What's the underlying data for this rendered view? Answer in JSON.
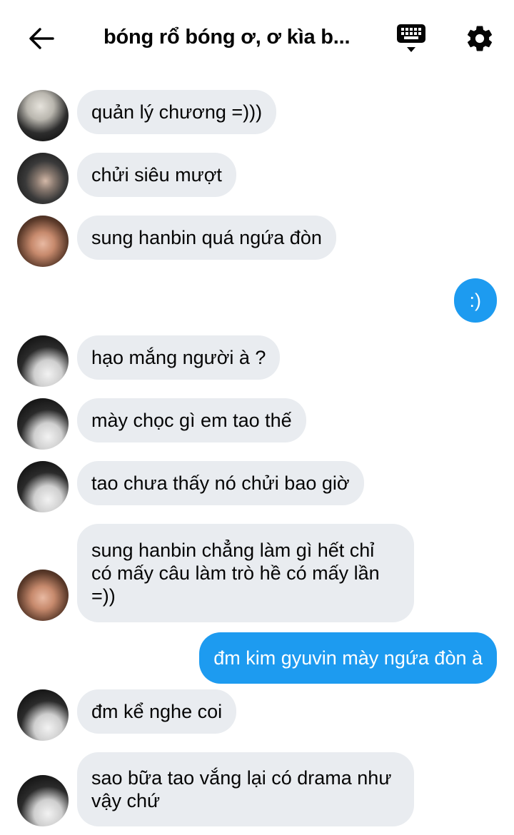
{
  "header": {
    "title": "bóng rổ bóng ơ, ơ kìa b...",
    "back_icon": "arrow-left-icon",
    "keyboard_icon": "keyboard-icon",
    "settings_icon": "gear-icon"
  },
  "colors": {
    "incoming_bubble": "#e9ecf0",
    "outgoing_bubble": "#1d9bf0",
    "text": "#050505"
  },
  "messages": [
    {
      "direction": "incoming",
      "text": "quản lý chương =)))"
    },
    {
      "direction": "incoming",
      "text": "chửi siêu mượt"
    },
    {
      "direction": "incoming",
      "text": "sung hanbin quá ngứa đòn"
    },
    {
      "direction": "outgoing",
      "text": ":)"
    },
    {
      "direction": "incoming",
      "text": "hạo mắng người à ?"
    },
    {
      "direction": "incoming",
      "text": "mày chọc gì em tao thế"
    },
    {
      "direction": "incoming",
      "text": "tao chưa thấy nó chửi bao giờ"
    },
    {
      "direction": "incoming",
      "text": "sung hanbin chẳng làm gì  hết chỉ có mấy câu làm trò hề có mấy lần =))"
    },
    {
      "direction": "outgoing",
      "text": "đm kim gyuvin mày ngứa đòn à"
    },
    {
      "direction": "incoming",
      "text": "đm kể nghe coi"
    },
    {
      "direction": "incoming",
      "text": "sao bữa tao vắng lại có drama như vậy chứ"
    }
  ]
}
